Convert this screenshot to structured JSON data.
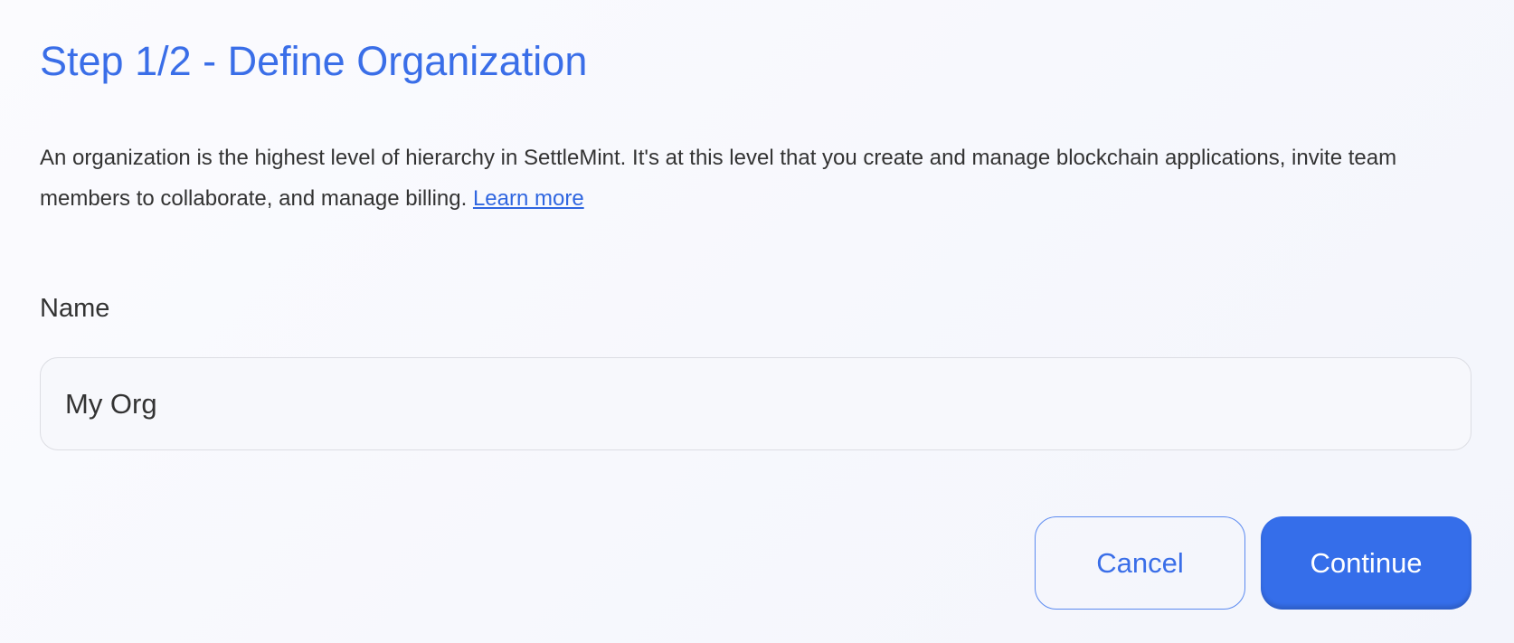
{
  "header": {
    "title": "Step 1/2 - Define Organization"
  },
  "description": {
    "text": "An organization is the highest level of hierarchy in SettleMint. It's at this level that you create and manage blockchain applications, invite team members to collaborate, and manage billing. ",
    "link_label": "Learn more"
  },
  "form": {
    "name_label": "Name",
    "name_value": "My Org"
  },
  "actions": {
    "cancel_label": "Cancel",
    "continue_label": "Continue"
  },
  "colors": {
    "accent": "#356eea",
    "title": "#3a6ee8",
    "background": "#f5f6fc"
  }
}
